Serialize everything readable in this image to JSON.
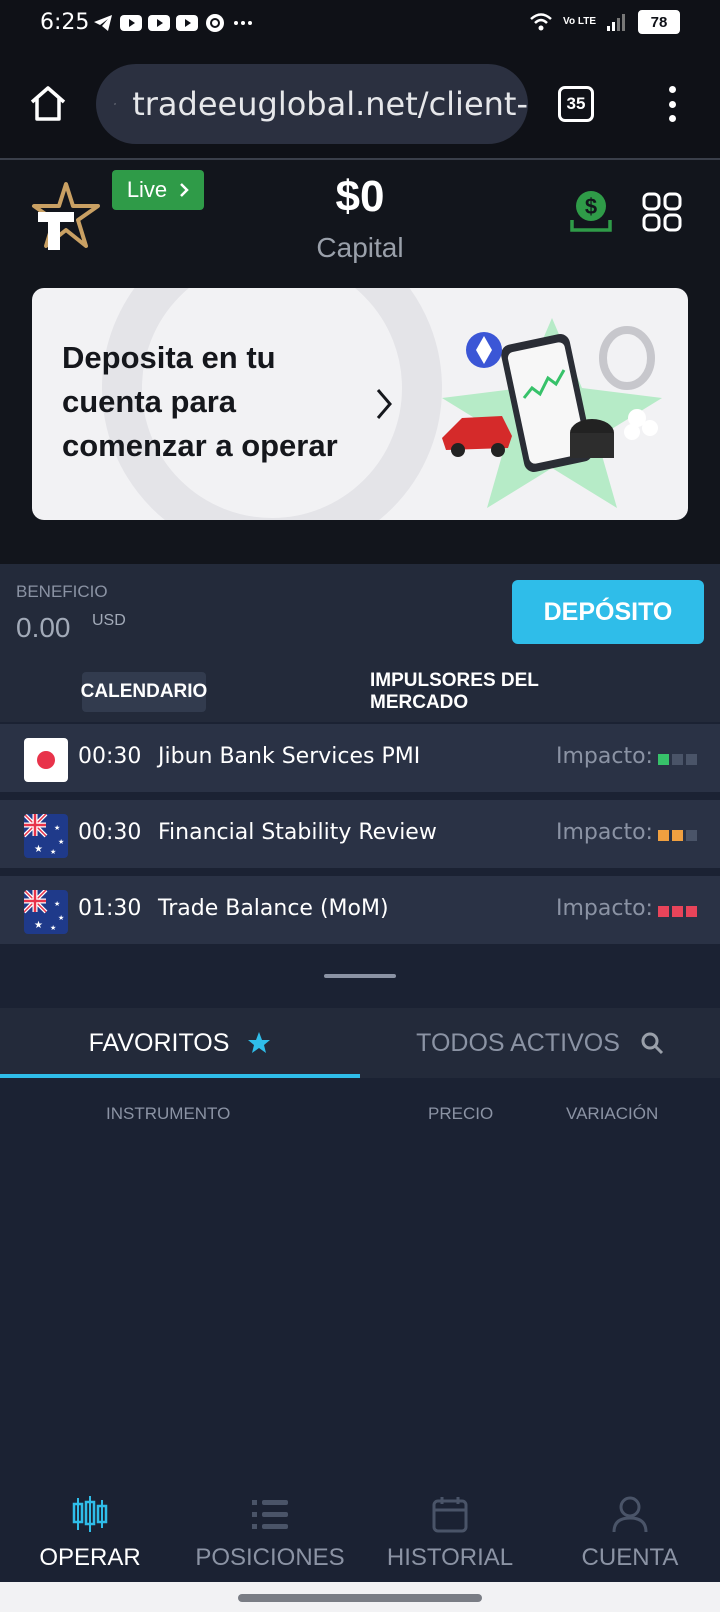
{
  "status_bar": {
    "time": "6:25",
    "network": "Vo LTE",
    "battery": "78"
  },
  "browser": {
    "url": "tradeeuglobal.net/client-",
    "tab_count": "35"
  },
  "header": {
    "live_label": "Live",
    "capital_amount": "$0",
    "capital_label": "Capital"
  },
  "promo": {
    "text": "Deposita en tu cuenta para comenzar a operar"
  },
  "profit": {
    "label": "BENEFICIO",
    "value": "0.00",
    "currency": "USD",
    "deposit_button": "DEPÓSITO"
  },
  "event_tabs": {
    "calendar": "CALENDARIO",
    "market_movers": "IMPULSORES DEL MERCADO"
  },
  "events": [
    {
      "flag": "japan",
      "time": "00:30",
      "name": "Jibun Bank Services PMI",
      "impact_label": "Impacto:",
      "impact_level": 1,
      "impact_color": "#37c26a"
    },
    {
      "flag": "australia",
      "time": "00:30",
      "name": "Financial Stability Review",
      "impact_label": "Impacto:",
      "impact_level": 2,
      "impact_color": "#f0a040"
    },
    {
      "flag": "australia",
      "time": "01:30",
      "name": "Trade Balance (MoM)",
      "impact_label": "Impacto:",
      "impact_level": 3,
      "impact_color": "#e8445a"
    }
  ],
  "asset_tabs": {
    "favorites": "FAVORITOS",
    "all_assets": "TODOS ACTIVOS"
  },
  "columns": {
    "instrument": "INSTRUMENTO",
    "price": "PRECIO",
    "change": "VARIACIÓN"
  },
  "bottom_nav": [
    {
      "label": "OPERAR",
      "icon": "candlestick-icon",
      "active": true
    },
    {
      "label": "POSICIONES",
      "icon": "list-icon",
      "active": false
    },
    {
      "label": "HISTORIAL",
      "icon": "calendar-icon",
      "active": false
    },
    {
      "label": "CUENTA",
      "icon": "person-icon",
      "active": false
    }
  ],
  "colors": {
    "accent": "#2fbde9",
    "live_green": "#2f9b48",
    "background": "#1b2233"
  }
}
